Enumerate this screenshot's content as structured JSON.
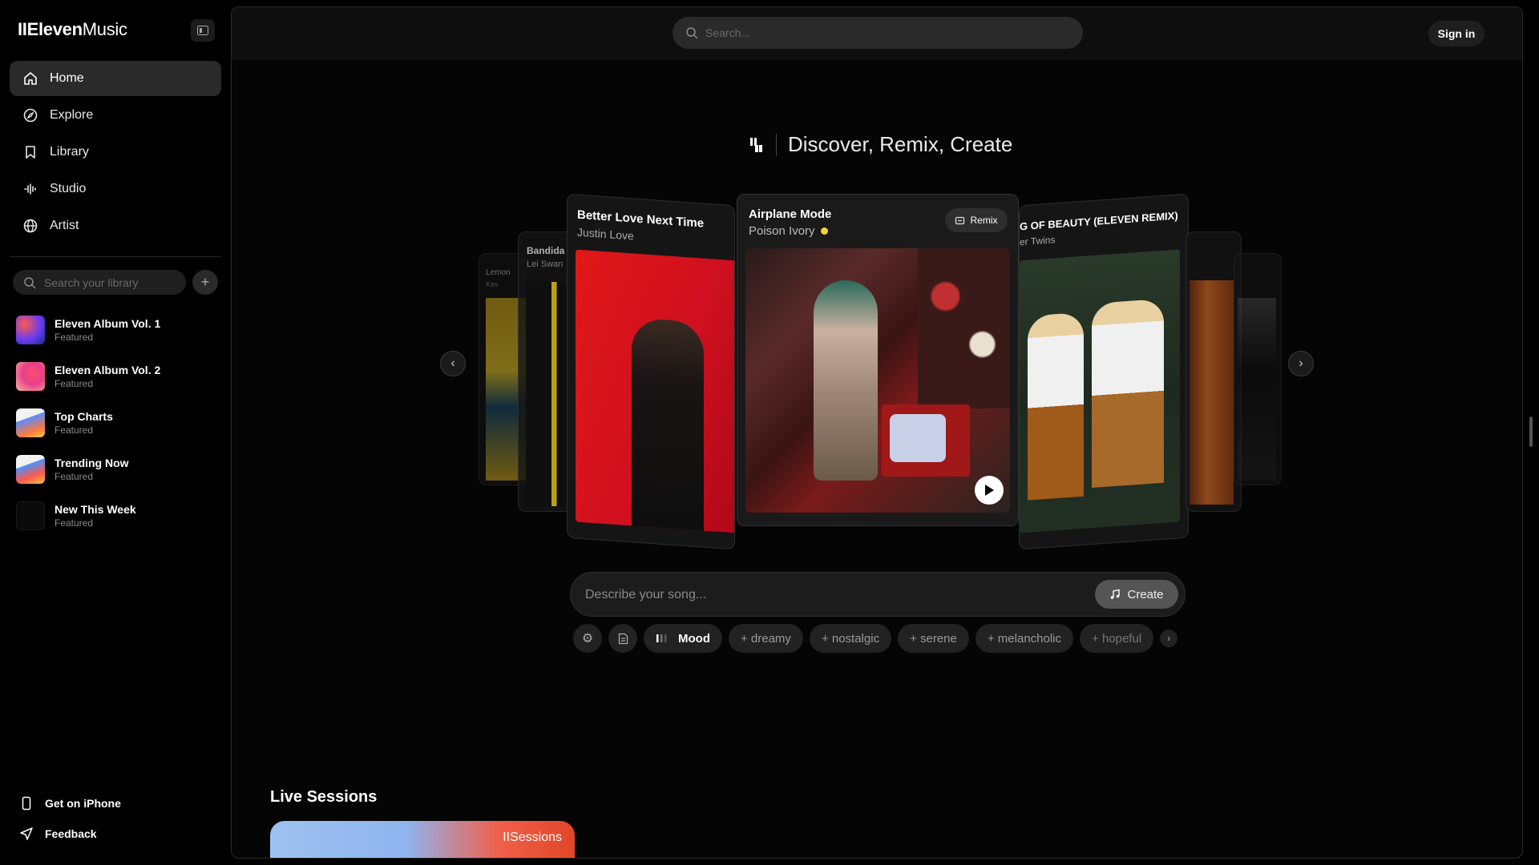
{
  "app": {
    "logo_prefix": "II",
    "logo_bold": "Eleven",
    "logo_light": "Music"
  },
  "nav": [
    {
      "label": "Home",
      "icon": "home-icon",
      "active": true
    },
    {
      "label": "Explore",
      "icon": "compass-icon",
      "active": false
    },
    {
      "label": "Library",
      "icon": "bookmark-icon",
      "active": false
    },
    {
      "label": "Studio",
      "icon": "waveform-icon",
      "active": false
    },
    {
      "label": "Artist",
      "icon": "globe-icon",
      "active": false
    }
  ],
  "library": {
    "search_placeholder": "Search your library",
    "items": [
      {
        "title": "Eleven Album Vol. 1",
        "subtitle": "Featured"
      },
      {
        "title": "Eleven Album Vol. 2",
        "subtitle": "Featured"
      },
      {
        "title": "Top Charts",
        "subtitle": "Featured"
      },
      {
        "title": "Trending Now",
        "subtitle": "Featured"
      },
      {
        "title": "New This Week",
        "subtitle": "Featured"
      }
    ]
  },
  "footer": {
    "iphone": "Get on iPhone",
    "feedback": "Feedback"
  },
  "header": {
    "search_placeholder": "Search...",
    "sign_in": "Sign in"
  },
  "hero": {
    "title": "Discover, Remix, Create"
  },
  "carousel": {
    "featured": {
      "title": "Airplane Mode",
      "artist": "Poison Ivory",
      "remix_label": "Remix"
    },
    "cards": [
      {
        "title": "Lemon",
        "artist": "Kes"
      },
      {
        "title": "Bandida",
        "artist": "Lei Swan"
      },
      {
        "title": "Better Love Next Time",
        "artist": "Justin Love"
      },
      {
        "title": "G OF BEAUTY (ELEVEN REMIX)",
        "artist": "er Twins"
      }
    ]
  },
  "create": {
    "placeholder": "Describe your song...",
    "button": "Create"
  },
  "chips": {
    "mood": "Mood",
    "tags": [
      "+ dreamy",
      "+ nostalgic",
      "+ serene",
      "+ melancholic",
      "+ hopeful"
    ]
  },
  "live": {
    "title": "Live Sessions",
    "banner": "IISessions"
  },
  "colors": {
    "accent_dot": "#f5d531",
    "background": "#000000",
    "active_nav": "#2a2a2a"
  }
}
